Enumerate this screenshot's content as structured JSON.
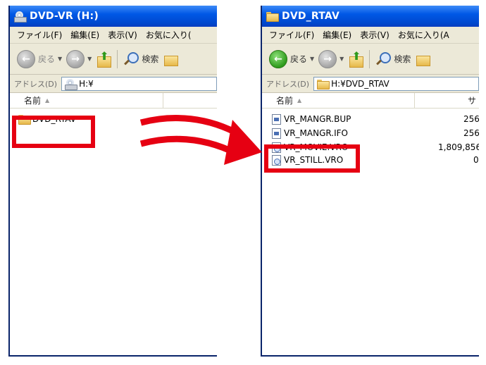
{
  "left_window": {
    "title": "DVD-VR (H:)",
    "menu": [
      "ファイル(F)",
      "編集(E)",
      "表示(V)",
      "お気に入り("
    ],
    "toolbar": {
      "back_label": "戻る",
      "search_label": "検索"
    },
    "address": {
      "label": "アドレス(D)",
      "value": "H:¥"
    },
    "columns": {
      "name": "名前"
    },
    "items": [
      {
        "name": "DVD_RTAV"
      }
    ]
  },
  "right_window": {
    "title": "DVD_RTAV",
    "menu": [
      "ファイル(F)",
      "編集(E)",
      "表示(V)",
      "お気に入り(A"
    ],
    "toolbar": {
      "back_label": "戻る",
      "search_label": "検索"
    },
    "address": {
      "label": "アドレス(D)",
      "value": "H:¥DVD_RTAV"
    },
    "columns": {
      "name": "名前",
      "size": "サ"
    },
    "files": [
      {
        "name": "VR_MANGR.BUP",
        "size": "256"
      },
      {
        "name": "VR_MANGR.IFO",
        "size": "256"
      },
      {
        "name": "VR_MOVIE.VRO",
        "size": "1,809,856"
      },
      {
        "name": "VR_STILL.VRO",
        "size": "0"
      }
    ]
  },
  "colors": {
    "highlight": "#e60012",
    "titlebar": "#0058e6",
    "chrome": "#ece9d8"
  }
}
